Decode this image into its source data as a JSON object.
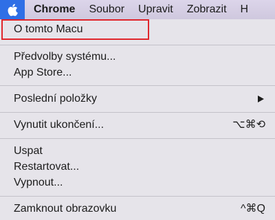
{
  "menubar": {
    "apple_icon": "apple-logo-icon",
    "app_name": "Chrome",
    "items": [
      "Soubor",
      "Upravit",
      "Zobrazit",
      "H"
    ]
  },
  "apple_menu": {
    "about": "O tomto Macu",
    "system_prefs": "Předvolby systému...",
    "app_store": "App Store...",
    "recent_items": "Poslední položky",
    "force_quit": "Vynutit ukončení...",
    "force_quit_shortcut": "⌥⌘⟲",
    "sleep": "Uspat",
    "restart": "Restartovat...",
    "shut_down": "Vypnout...",
    "lock_screen": "Zamknout obrazovku",
    "lock_screen_shortcut": "^⌘Q"
  },
  "colors": {
    "apple_tab": "#2f6fe6",
    "highlight_box": "#e0252b"
  }
}
